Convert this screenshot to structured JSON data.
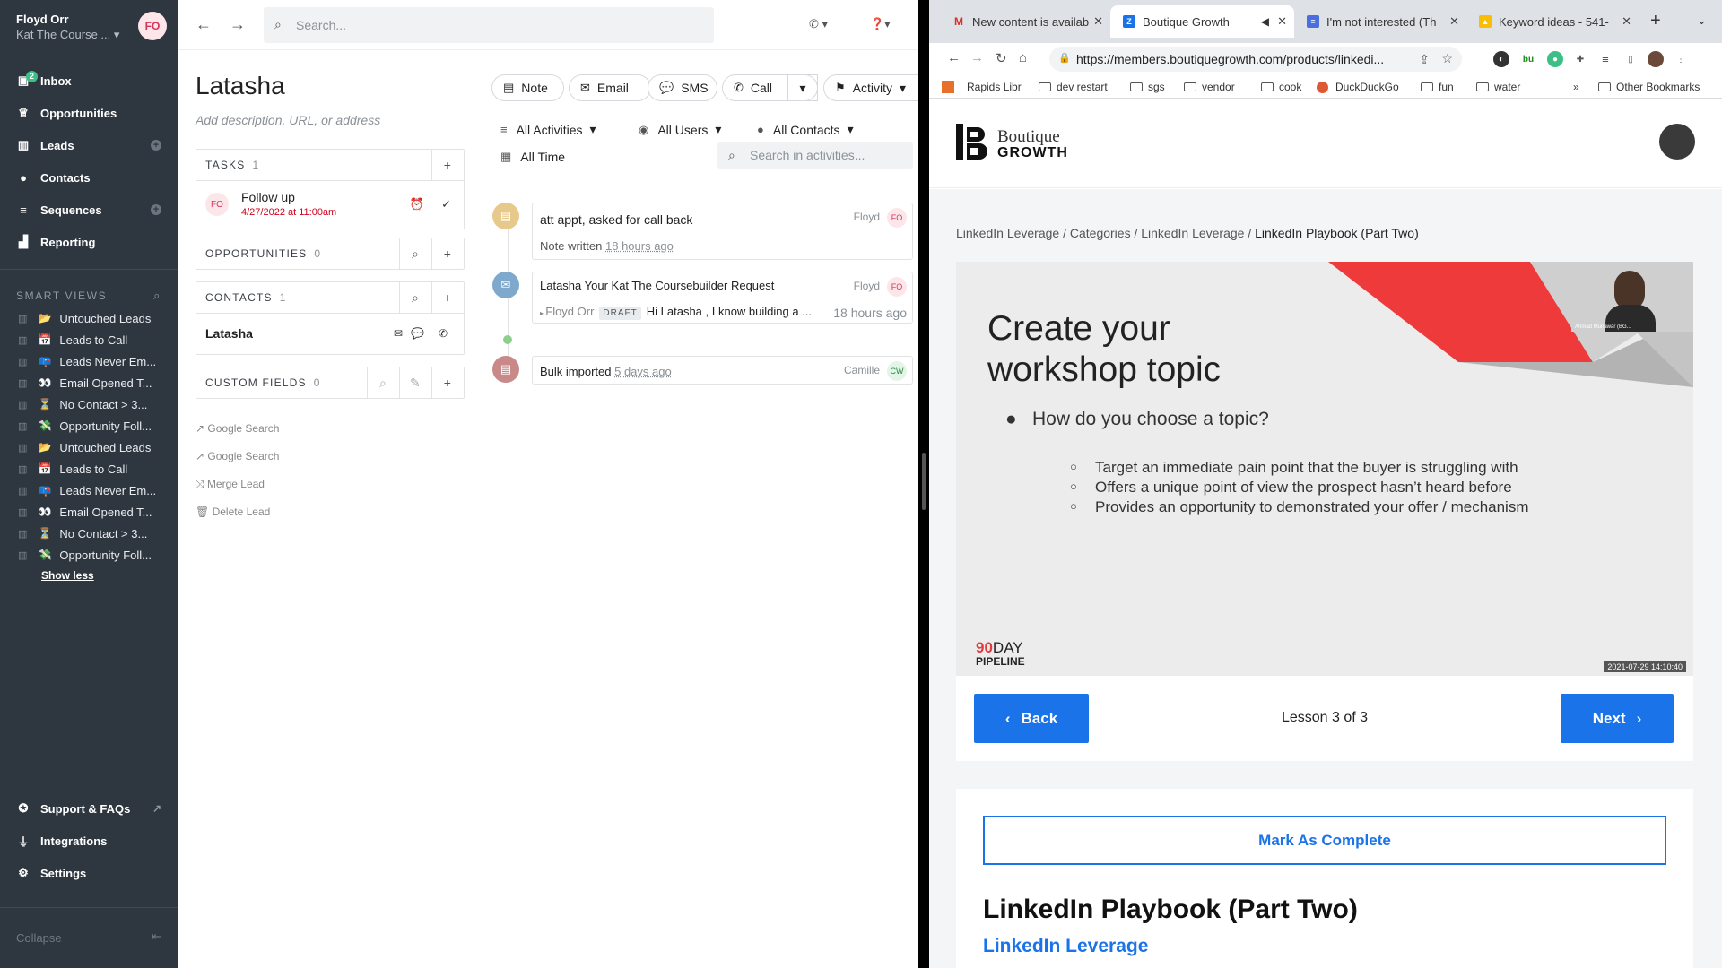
{
  "crm": {
    "user": "Floyd Orr",
    "org": "Kat The Course ...",
    "avatar": "FO",
    "nav": [
      {
        "label": "Inbox",
        "badge": "2"
      },
      {
        "label": "Opportunities"
      },
      {
        "label": "Leads"
      },
      {
        "label": "Contacts"
      },
      {
        "label": "Sequences"
      },
      {
        "label": "Reporting"
      }
    ],
    "smart_views_title": "SMART VIEWS",
    "smart_views": [
      {
        "emoji": "📂",
        "label": "Untouched Leads"
      },
      {
        "emoji": "📅",
        "label": "Leads to Call"
      },
      {
        "emoji": "📪",
        "label": "Leads Never Em..."
      },
      {
        "emoji": "👀",
        "label": "Email Opened T..."
      },
      {
        "emoji": "⏳",
        "label": "No Contact > 3..."
      },
      {
        "emoji": "💸",
        "label": "Opportunity Foll..."
      },
      {
        "emoji": "📂",
        "label": "Untouched Leads"
      },
      {
        "emoji": "📅",
        "label": "Leads to Call"
      },
      {
        "emoji": "📪",
        "label": "Leads Never Em..."
      },
      {
        "emoji": "👀",
        "label": "Email Opened T..."
      },
      {
        "emoji": "⏳",
        "label": "No Contact > 3..."
      },
      {
        "emoji": "💸",
        "label": "Opportunity Foll..."
      }
    ],
    "show_less": "Show less",
    "bottom": [
      {
        "label": "Support & FAQs"
      },
      {
        "label": "Integrations"
      },
      {
        "label": "Settings"
      }
    ],
    "collapse": "Collapse",
    "search_placeholder": "Search...",
    "lead": {
      "name": "Latasha",
      "desc_placeholder": "Add description, URL, or address"
    },
    "tasks": {
      "title": "TASKS",
      "count": "1",
      "item": "Follow up",
      "date": "4/27/2022 at 11:00am"
    },
    "opportunities": {
      "title": "OPPORTUNITIES",
      "count": "0"
    },
    "contacts": {
      "title": "CONTACTS",
      "count": "1",
      "name": "Latasha"
    },
    "custom_fields": {
      "title": "CUSTOM FIELDS",
      "count": "0"
    },
    "links": [
      "Google Search",
      "Google Search",
      "Merge Lead",
      "Delete Lead"
    ],
    "actions": [
      "Note",
      "Email",
      "SMS",
      "Call",
      "Activity"
    ],
    "filters": {
      "activities": "All Activities",
      "users": "All Users",
      "contacts": "All Contacts",
      "time": "All Time",
      "search_placeholder": "Search in activities..."
    },
    "activity": [
      {
        "title": "att appt, asked for call back",
        "sub": "Note written",
        "ago": "18 hours ago",
        "who": "Floyd",
        "av": "FO"
      },
      {
        "title": "Latasha Your Kat The Coursebuilder Request",
        "who": "Floyd",
        "av": "FO",
        "from": "Floyd Orr",
        "draft": "DRAFT",
        "snippet": "Hi Latasha , I know building a ...",
        "ago": "18 hours ago"
      },
      {
        "title": "Bulk imported",
        "ago": "5 days ago",
        "who": "Camille",
        "av": "CW"
      }
    ]
  },
  "browser": {
    "tabs": [
      "New content is availab",
      "Boutique Growth",
      "I'm not interested (Th",
      "Keyword ideas - 541-"
    ],
    "url": "https://members.boutiquegrowth.com/products/linkedi...",
    "bookmarks": [
      "Rapids Libr",
      "dev restart",
      "sgs",
      "vendor",
      "cook",
      "DuckDuckGo",
      "fun",
      "water",
      "Other Bookmarks"
    ],
    "logo": {
      "line1": "Boutique",
      "line2": "GROWTH"
    },
    "breadcrumb": [
      "LinkedIn Leverage",
      "Categories",
      "LinkedIn Leverage",
      "LinkedIn Playbook (Part Two)"
    ],
    "slide": {
      "title_l1": "Create your",
      "title_l2": "workshop topic",
      "question": "How do you choose a topic?",
      "points": [
        "Target an immediate pain point that the buyer is struggling with",
        "Offers a unique point of view the prospect hasn’t heard before",
        "Provides an opportunity to demonstrated your offer / mechanism"
      ],
      "brand_num": "90",
      "brand_word": "DAY",
      "brand_line2": "PIPELINE",
      "timestamp": "2021-07-29 14:10:40",
      "presenter": "Ahmad Munawar (BG..."
    },
    "back": "Back",
    "next": "Next",
    "lesson": "Lesson 3 of 3",
    "mark_complete": "Mark As Complete",
    "lesson_title": "LinkedIn Playbook (Part Two)",
    "course": "LinkedIn Leverage"
  }
}
